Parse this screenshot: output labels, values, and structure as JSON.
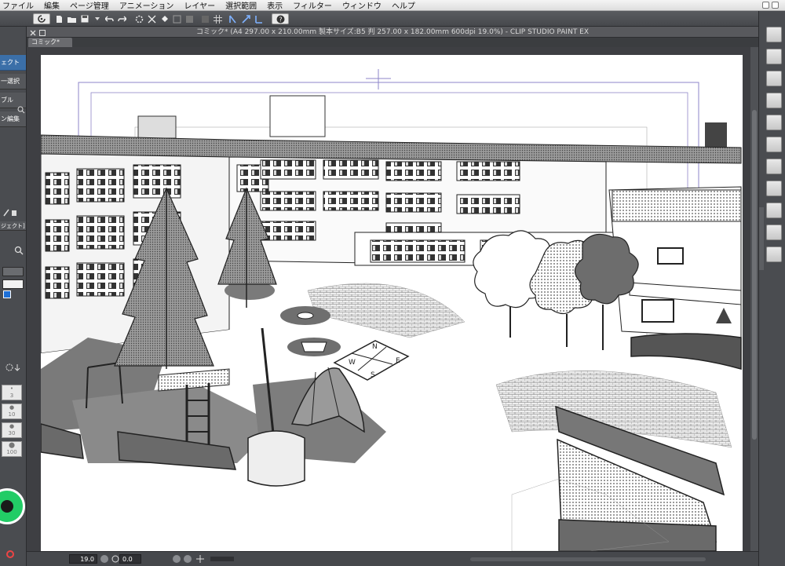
{
  "menubar": {
    "items": [
      "ファイル",
      "編集",
      "ページ管理",
      "アニメーション",
      "レイヤー",
      "選択範囲",
      "表示",
      "フィルター",
      "ウィンドウ",
      "ヘルプ"
    ]
  },
  "document": {
    "window_title": "コミック* (A4 297.00 x 210.00mm 製本サイズ:B5 判 257.00 x 182.00mm 600dpi 19.0%)  - CLIP STUDIO PAINT EX",
    "tab_label": "コミック*"
  },
  "left_panel": {
    "items": [
      "ェクト",
      "一選択",
      "ブル",
      "ン編集"
    ],
    "layer_label": "ジェクト]",
    "brush_sizes": [
      "3",
      "10",
      "30",
      "100"
    ]
  },
  "status": {
    "zoom": "19.0",
    "angle": "0.0"
  },
  "canvas": {
    "compass_letters": [
      "N",
      "E",
      "W",
      "S"
    ]
  },
  "colors": {
    "ui_dark": "#3e3f43",
    "selection_blue": "#3b6fa8",
    "color_wheel": "#22cc66"
  }
}
